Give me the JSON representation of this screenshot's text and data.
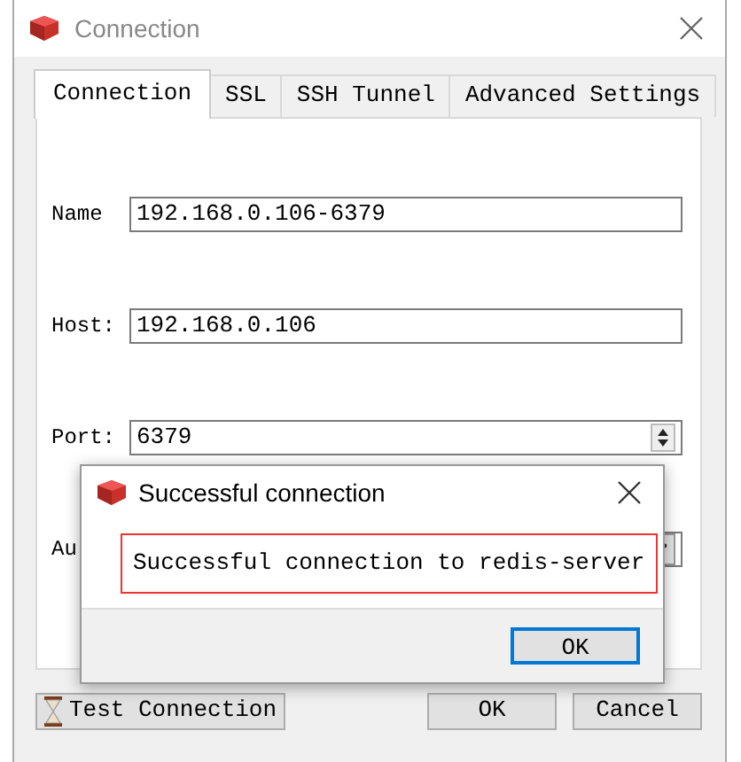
{
  "window": {
    "title": "Connection"
  },
  "tabs": [
    {
      "label": "Connection",
      "selected": true
    },
    {
      "label": "SSL",
      "selected": false
    },
    {
      "label": "SSH Tunnel",
      "selected": false
    },
    {
      "label": "Advanced Settings",
      "selected": false
    }
  ],
  "fields": [
    {
      "label": "Name",
      "value": "192.168.0.106-6379",
      "kind": "text"
    },
    {
      "label": "Host:",
      "value": "192.168.0.106",
      "kind": "text"
    },
    {
      "label": "Port:",
      "value": "6379",
      "kind": "spin"
    },
    {
      "label": "Au",
      "kind": "browse"
    }
  ],
  "buttons": [
    {
      "label": "Test Connection",
      "kind": "test"
    },
    {
      "label": "OK",
      "kind": "plain"
    },
    {
      "label": "Cancel",
      "kind": "plain"
    }
  ],
  "message_box": {
    "title": "Successful connection",
    "message": "Successful connection to redis-server",
    "button": "OK"
  }
}
